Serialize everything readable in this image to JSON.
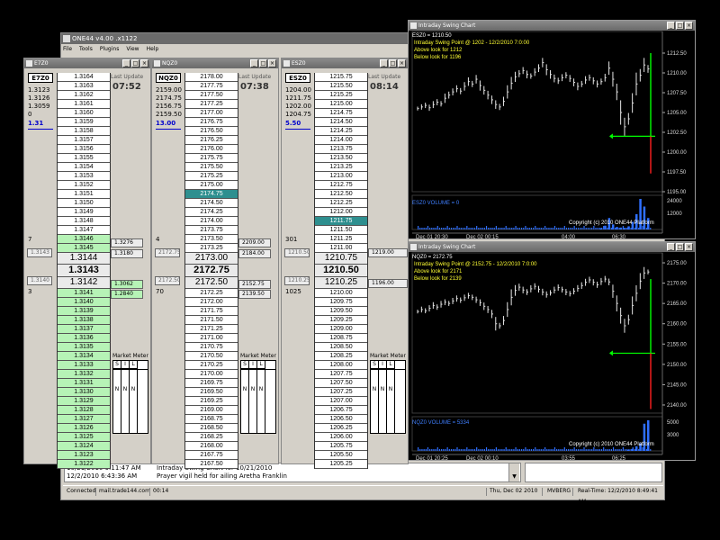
{
  "main_window": {
    "title": "ONE44 v4.00 .x1122",
    "menu": [
      "File",
      "Tools",
      "Plugins",
      "View",
      "Help"
    ]
  },
  "ladders": [
    {
      "title": "E7Z0",
      "symbol": "E7Z0",
      "side_values": [
        "1.3123",
        "1.3126",
        "1.3059",
        "0"
      ],
      "net": "1.31",
      "last_update_label": "Last Update",
      "time": "07:52",
      "left_markers": {
        "bid_size": "7",
        "last_left": "1.3143",
        "ask_left": "1.3140",
        "ask_size": "3"
      },
      "right_boxes": [
        "1.3276",
        "1.3180",
        "1.3062",
        "1.2840"
      ],
      "prices_above": [
        "1.3164",
        "1.3163",
        "1.3162",
        "1.3161",
        "1.3160",
        "1.3159",
        "1.3158",
        "1.3157",
        "1.3156",
        "1.3155",
        "1.3154",
        "1.3153",
        "1.3152",
        "1.3151",
        "1.3150",
        "1.3149",
        "1.3148",
        "1.3147",
        "1.3146",
        "1.3145"
      ],
      "center": [
        "1.3144",
        "1.3143",
        "1.3142"
      ],
      "prices_below": [
        "1.3141",
        "1.3140",
        "1.3139",
        "1.3138",
        "1.3137",
        "1.3136",
        "1.3135",
        "1.3134",
        "1.3133",
        "1.3132",
        "1.3131",
        "1.3130",
        "1.3129",
        "1.3128",
        "1.3127",
        "1.3126",
        "1.3125",
        "1.3124",
        "1.3123",
        "1.3122"
      ],
      "highlight_above": [],
      "market_meter": {
        "title": "Market Meter",
        "cols": [
          "S",
          "I",
          "L"
        ],
        "values": [
          "N",
          "N",
          "N"
        ]
      }
    },
    {
      "title": "NQZ0",
      "symbol": "NQZ0",
      "side_values": [
        "2159.00",
        "2174.75",
        "2156.75",
        "2159.50"
      ],
      "net": "13.00",
      "last_update_label": "Last Update",
      "time": "07:38",
      "left_markers": {
        "bid_size": "4",
        "last_left": "2172.75",
        "ask_left": "2172.50",
        "ask_size": "70"
      },
      "right_boxes": [
        "2209.00",
        "2184.00",
        "2152.75",
        "2139.50"
      ],
      "prices_above": [
        "2178.00",
        "2177.75",
        "2177.50",
        "2177.25",
        "2177.00",
        "2176.75",
        "2176.50",
        "2176.25",
        "2176.00",
        "2175.75",
        "2175.50",
        "2175.25",
        "2175.00",
        "2174.75",
        "2174.50",
        "2174.25",
        "2174.00",
        "2173.75",
        "2173.50",
        "2173.25"
      ],
      "center": [
        "2173.00",
        "2172.75",
        "2172.50"
      ],
      "prices_below": [
        "2172.25",
        "2172.00",
        "2171.75",
        "2171.50",
        "2171.25",
        "2171.00",
        "2170.75",
        "2170.50",
        "2170.25",
        "2170.00",
        "2169.75",
        "2169.50",
        "2169.25",
        "2169.00",
        "2168.75",
        "2168.50",
        "2168.25",
        "2168.00",
        "2167.75",
        "2167.50"
      ],
      "highlight_above": [
        13
      ],
      "market_meter": {
        "title": "Market Meter",
        "cols": [
          "S",
          "I",
          "L"
        ],
        "values": [
          "N",
          "N",
          "N"
        ]
      }
    },
    {
      "title": "ESZ0",
      "symbol": "ESZ0",
      "side_values": [
        "1204.00",
        "1211.75",
        "1202.00",
        "1204.75"
      ],
      "net": "5.50",
      "last_update_label": "Last Update",
      "time": "08:14",
      "left_markers": {
        "bid_size": "301",
        "last_left": "1210.50",
        "ask_left": "1210.25",
        "ask_size": "1025"
      },
      "right_boxes": [
        "1219.00",
        "1196.00"
      ],
      "prices_above": [
        "1215.75",
        "1215.50",
        "1215.25",
        "1215.00",
        "1214.75",
        "1214.50",
        "1214.25",
        "1214.00",
        "1213.75",
        "1213.50",
        "1213.25",
        "1213.00",
        "1212.75",
        "1212.50",
        "1212.25",
        "1212.00",
        "1211.75",
        "1211.50",
        "1211.25",
        "1211.00"
      ],
      "center": [
        "1210.75",
        "1210.50",
        "1210.25"
      ],
      "prices_below": [
        "1210.00",
        "1209.75",
        "1209.50",
        "1209.25",
        "1209.00",
        "1208.75",
        "1208.50",
        "1208.25",
        "1208.00",
        "1207.75",
        "1207.50",
        "1207.25",
        "1207.00",
        "1206.75",
        "1206.50",
        "1206.25",
        "1206.00",
        "1205.75",
        "1205.50",
        "1205.25"
      ],
      "highlight_above": [
        16
      ],
      "market_meter": {
        "title": "Market Meter",
        "cols": [
          "S",
          "I",
          "L"
        ],
        "values": [
          "N",
          "N",
          "N"
        ]
      }
    }
  ],
  "charts": {
    "es": {
      "window_title": "Intraday Swing Chart",
      "header": "ESZ0 = 1210.50",
      "swing_line": "Intraday Swing Point @ 1202 - 12/2/2010 7:0:00",
      "above": "Above look for 1212",
      "below": "Below look for 1196",
      "y_ticks": [
        "1212.50",
        "1210.00",
        "1207.50",
        "1205.00",
        "1202.50",
        "1200.00",
        "1197.50",
        "1195.00"
      ],
      "volume_label": "ESZ0 VOLUME = 0",
      "volume_ticks": [
        "24000",
        "12000"
      ],
      "copyright": "Copyright (c) 2010 ONE44 Platform",
      "x_ticks": [
        "Dec 01 20:30",
        "Dec 02 00:15",
        "04:00",
        "06:30"
      ]
    },
    "nq": {
      "window_title": "Intraday Swing Chart",
      "header": "NQZ0",
      "swing_line": "Intraday Swing Point @ 2152.75 - 12/2/2010 7:0:00",
      "above": "Above look for 2171",
      "below": "Below look for 2139",
      "y_ticks": [
        "2175.00",
        "2170.00",
        "2165.00",
        "2160.00",
        "2155.00",
        "2150.00",
        "2145.00",
        "2140.00"
      ],
      "volume_label": "NQZ0 VOLUME = 5334",
      "volume_ticks": [
        "5000",
        "3000"
      ],
      "copyright": "Copyright (c) 2010 ONE44 Platform",
      "x_ticks": [
        "Dec 01 20:25",
        "Dec 02 00:10",
        "03:55",
        "06:25"
      ],
      "header_value": "2172.75"
    }
  },
  "chart_data": [
    {
      "type": "line",
      "title": "ESZ0",
      "ylim": [
        1195,
        1215
      ],
      "series": [
        {
          "name": "ESZ0",
          "values": [
            1205.5,
            1205.7,
            1205.9,
            1205.6,
            1206.0,
            1206.3,
            1206.1,
            1206.8,
            1207.2,
            1207.6,
            1208.0,
            1207.7,
            1208.3,
            1208.9,
            1208.6,
            1209.2,
            1208.4,
            1207.8,
            1207.2,
            1206.6,
            1206.0,
            1205.7,
            1206.4,
            1207.6,
            1208.7,
            1209.5,
            1209.9,
            1210.3,
            1209.8,
            1209.6,
            1210.1,
            1210.6,
            1211.3,
            1210.4,
            1209.8,
            1209.3,
            1209.0,
            1209.4,
            1209.7,
            1209.3,
            1208.8,
            1208.3,
            1208.6,
            1209.1,
            1209.4,
            1209.0,
            1208.6,
            1208.9,
            1209.4,
            1210.6,
            1209.2,
            1207.6,
            1205.0,
            1203.2,
            1204.2,
            1206.2,
            1208.6,
            1209.7,
            1211.0,
            1210.5
          ]
        }
      ],
      "volume": [
        0,
        0,
        0,
        0,
        0,
        0,
        0,
        0,
        0,
        0,
        0,
        0,
        0,
        0,
        0,
        0,
        0,
        0,
        0,
        0,
        0,
        0,
        0,
        0,
        0,
        0,
        0,
        0,
        0,
        0,
        0,
        0,
        0,
        0,
        0,
        0,
        0,
        0,
        0,
        0,
        0,
        0,
        0,
        0,
        0,
        0,
        0,
        1000,
        3000,
        9000,
        4000,
        2000,
        1500,
        1200,
        2500,
        6000,
        12000,
        24000,
        18000,
        9000
      ]
    },
    {
      "type": "line",
      "title": "NQZ0",
      "ylim": [
        2138,
        2177
      ],
      "series": [
        {
          "name": "NQZ0",
          "values": [
            2163.0,
            2163.5,
            2163.2,
            2163.8,
            2164.5,
            2164.1,
            2164.8,
            2165.3,
            2165.0,
            2165.6,
            2166.2,
            2165.8,
            2166.4,
            2166.9,
            2166.5,
            2165.9,
            2165.2,
            2164.3,
            2163.5,
            2162.4,
            2160.0,
            2159.5,
            2160.8,
            2163.5,
            2166.5,
            2168.2,
            2169.0,
            2168.3,
            2167.8,
            2168.6,
            2169.2,
            2168.5,
            2167.8,
            2167.2,
            2167.6,
            2168.3,
            2168.9,
            2168.4,
            2167.8,
            2167.4,
            2168.0,
            2168.7,
            2169.4,
            2170.2,
            2170.8,
            2170.2,
            2169.6,
            2170.4,
            2171.0,
            2170.3,
            2168.0,
            2165.0,
            2162.0,
            2159.5,
            2161.0,
            2164.5,
            2167.5,
            2170.5,
            2172.5,
            2172.75
          ]
        }
      ],
      "volume": [
        0,
        0,
        0,
        0,
        0,
        0,
        0,
        0,
        0,
        0,
        0,
        0,
        0,
        0,
        0,
        0,
        0,
        0,
        0,
        0,
        0,
        0,
        0,
        0,
        0,
        0,
        0,
        0,
        0,
        0,
        0,
        0,
        0,
        0,
        0,
        0,
        0,
        0,
        0,
        0,
        0,
        0,
        0,
        0,
        0,
        0,
        0,
        0,
        0,
        0,
        0,
        0,
        0,
        0,
        200,
        400,
        900,
        1500,
        5334,
        6000
      ]
    }
  ],
  "news": [
    {
      "time": "10/21/2010 9:11:47 AM",
      "text": "Intraday Swing Chart for 10/21/2010"
    },
    {
      "time": "12/2/2010 6:43:36 AM",
      "text": "Prayer vigil held for ailing Aretha Franklin"
    }
  ],
  "status_bar": {
    "connection": "Connected",
    "server": "mail.trade144.com",
    "session": "00:14",
    "date": "Thu, Dec 02 2010",
    "user": "MVBERG",
    "realtime": "Real-Time: 12/2/2010 8:49:41 AM"
  },
  "colors": {
    "bid_green": "#b6f3b6",
    "marker_teal": "#2e8f8f",
    "chart_bg": "#000000",
    "overlay_yellow": "#ffff33",
    "swing_green": "#00ff00",
    "swing_red": "#ff2020",
    "volume_blue": "#2f6fff"
  }
}
